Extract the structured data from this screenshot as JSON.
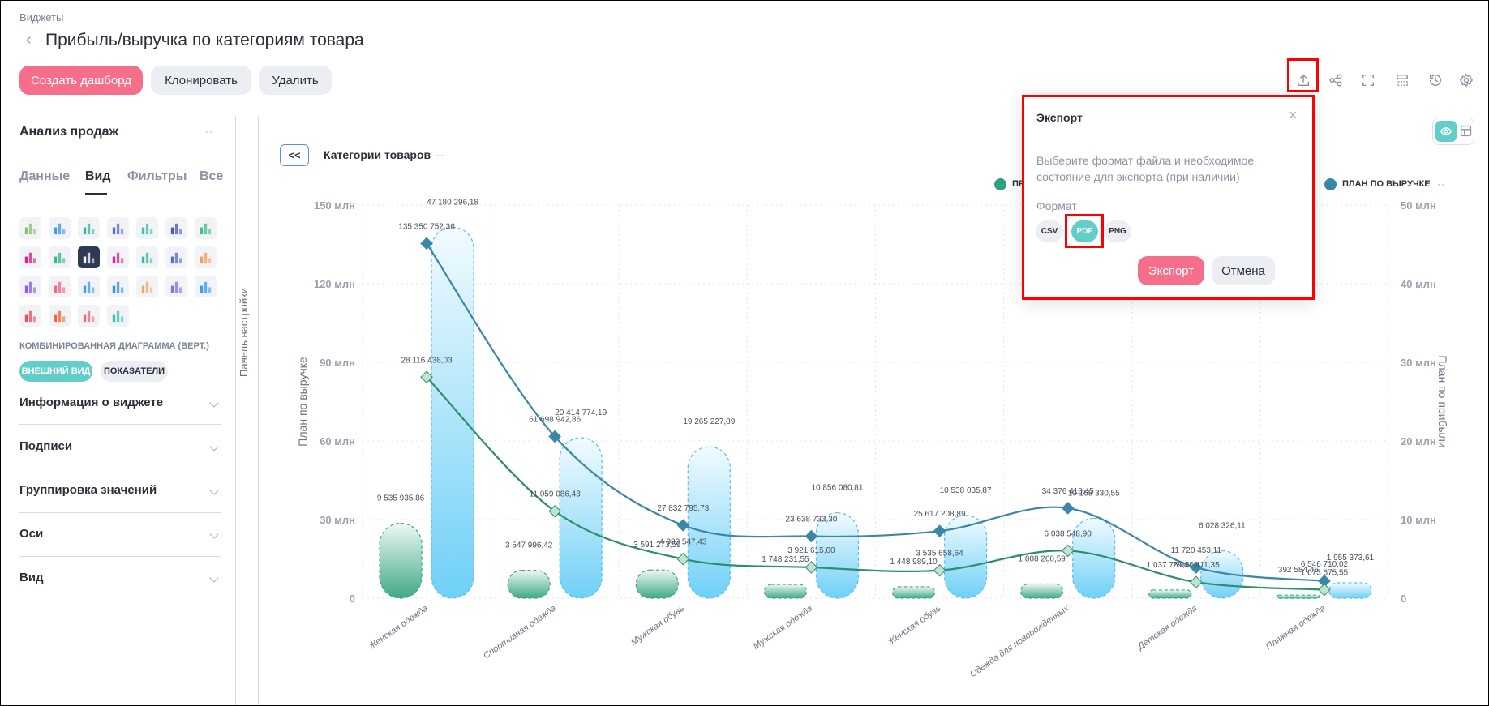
{
  "header": {
    "breadcrumb": "Виджеты",
    "title": "Прибыль/выручка по категориям товара",
    "buttons": {
      "create": "Создать дашборд",
      "clone": "Клонировать",
      "delete": "Удалить"
    },
    "toolbar_icons": [
      "export-icon",
      "share-icon",
      "fullscreen-icon",
      "layout-icon",
      "history-icon",
      "gear-icon"
    ]
  },
  "sidebar": {
    "title": "Анализ продаж",
    "tabs": [
      "Данные",
      "Вид",
      "Фильтры",
      "Все"
    ],
    "active_tab": "Вид",
    "chart_types": [
      "table",
      "pivot-table",
      "bar-chart",
      "stacked-bar",
      "horizontal-bar",
      "stacked-horizontal-bar",
      "radar",
      "line",
      "area",
      "combo-vertical",
      "combo-stacked",
      "combo-horizontal",
      "combo-horizontal-stacked",
      "pie",
      "donut",
      "pie-segments",
      "bubble",
      "treemap",
      "heatmap",
      "funnel",
      "matrix",
      "kpi-arrows",
      "html",
      "gantt",
      "gauge"
    ],
    "selected_chart_type": "combo-vertical",
    "chart_type_label": "КОМБИНИРОВАННАЯ ДИАГРАММА (ВЕРТ.)",
    "chips": [
      "ВНЕШНИЙ ВИД",
      "ПОКАЗАТЕЛИ"
    ],
    "sections": [
      "Информация о виджете",
      "Подписи",
      "Группировка значений",
      "Оси",
      "Вид"
    ],
    "panel_label": "Панель настройки"
  },
  "widget": {
    "collapse_label": "<<",
    "dimension": "Категории товаров"
  },
  "legend": [
    {
      "label": "ПР",
      "color": "#2fa07e"
    },
    {
      "label": "ПЛАН ПО ВЫРУЧКЕ",
      "color": "#3a86a8"
    }
  ],
  "dialog": {
    "title": "Экспорт",
    "description": "Выберите формат файла и необходимое состояние для экспорта (при наличии)",
    "format_label": "Формат",
    "formats": [
      "CSV",
      "PDF",
      "PNG"
    ],
    "selected_format": "PDF",
    "export": "Экспорт",
    "cancel": "Отмена"
  },
  "colors": {
    "accent": "#f56e8a",
    "teal": "#62ceca",
    "blue_line": "#3a86a8",
    "green_line": "#2b8f6a"
  },
  "chart_data": {
    "type": "bar",
    "categories": [
      "Женская одежда",
      "Спортивная одежда",
      "Мужская обувь",
      "Мужская одежда",
      "Женская обувь",
      "Одежда для новорожденных",
      "Детская одежда",
      "Пляжная одежда"
    ],
    "ylabel": "План по выручке",
    "y2label": "План по прибыли",
    "ylim": [
      0,
      150000000
    ],
    "y2lim": [
      0,
      50000000
    ],
    "yticks": [
      "0",
      "30 млн",
      "60 млн",
      "90 млн",
      "120 млн",
      "150 млн"
    ],
    "y2ticks": [
      "0",
      "10 млн",
      "20 млн",
      "30 млн",
      "40 млн",
      "50 млн"
    ],
    "grid": true,
    "legend_position": "top-right",
    "series": [
      {
        "kind": "bar",
        "axis": "right",
        "color": "#3fa882",
        "values": [
          9535935.86,
          3547996.42,
          3591273.59,
          1748231.55,
          1448989.1,
          1808260.59,
          1037759.36,
          392584.46
        ]
      },
      {
        "kind": "bar",
        "axis": "right",
        "color": "#5cc8f2",
        "values": [
          47180296.18,
          20414774.19,
          19265227.89,
          10856080.81,
          10538035.87,
          10168330.55,
          6028326.11,
          1955373.61
        ]
      },
      {
        "kind": "line",
        "axis": "left",
        "name": "План по выручке",
        "color": "#3a86a8",
        "values": [
          135350752.36,
          61698942.86,
          27832795.73,
          23638733.3,
          25617208.89,
          34376410.45,
          11720453.11,
          6546710.02
        ]
      },
      {
        "kind": "line",
        "axis": "right",
        "color": "#2b8f6a",
        "values": [
          28116438.03,
          11059086.43,
          4983547.43,
          3921615.0,
          3535658.64,
          6038548.9,
          2041411.35,
          1073675.55
        ]
      }
    ]
  }
}
